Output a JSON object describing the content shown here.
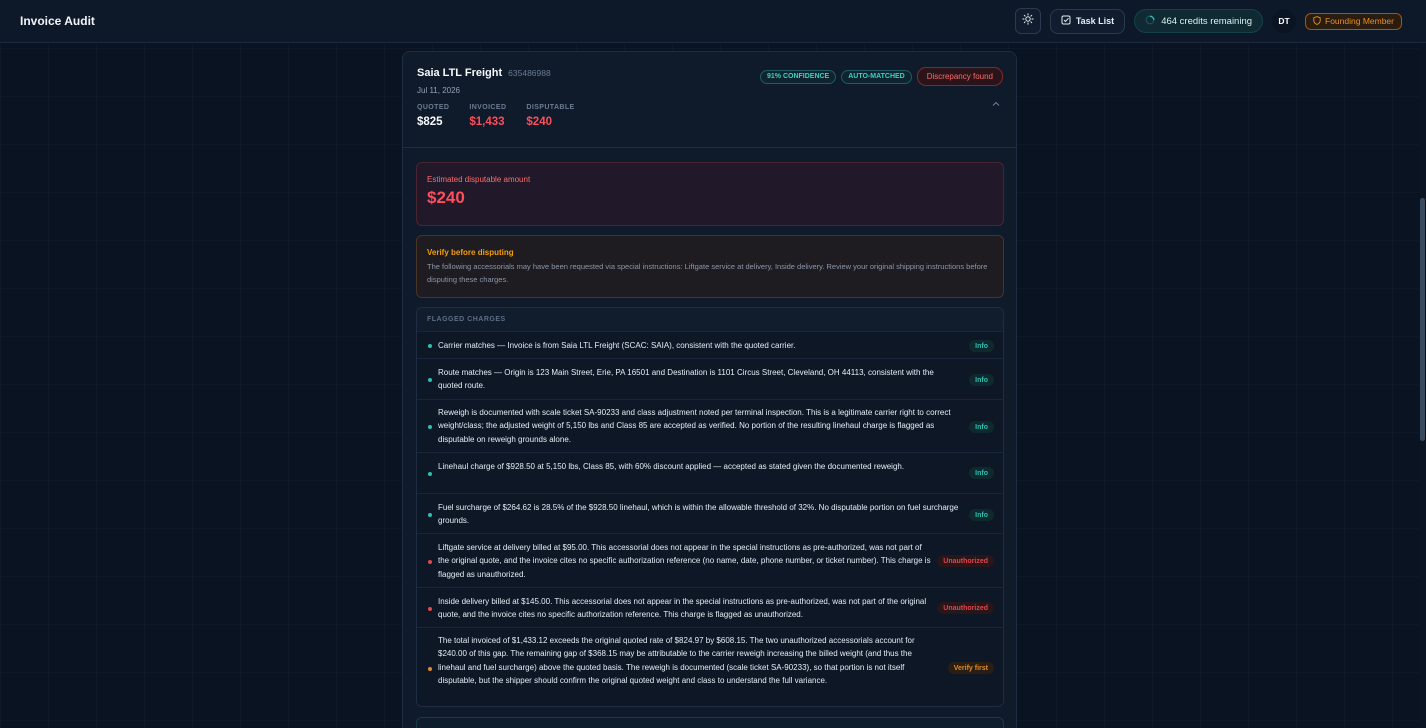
{
  "app": {
    "title": "Invoice Audit"
  },
  "header": {
    "task_list_label": "Task List",
    "credits_label": "464 credits remaining",
    "avatar_initials": "DT",
    "member_label": "Founding Member"
  },
  "invoice": {
    "carrier": "Saia LTL Freight",
    "invoice_number": "635486988",
    "date": "Jul 11, 2026",
    "confidence_badge": "91% CONFIDENCE",
    "match_badge": "AUTO-MATCHED",
    "status_badge": "Discrepancy found",
    "amounts": [
      {
        "label": "QUOTED",
        "value": "$825"
      },
      {
        "label": "INVOICED",
        "value": "$1,433"
      },
      {
        "label": "DISPUTABLE",
        "value": "$240"
      }
    ]
  },
  "estimate": {
    "label": "Estimated disputable amount",
    "value": "$240"
  },
  "verify": {
    "title": "Verify before disputing",
    "text": "The following accessorials may have been requested via special instructions: Liftgate service at delivery, Inside delivery. Review your original shipping instructions before disputing these charges."
  },
  "flagged": {
    "heading": "FLAGGED CHARGES",
    "items": [
      {
        "text": "Carrier matches — Invoice is from Saia LTL Freight (SCAC: SAIA), consistent with the quoted carrier.",
        "tag": "Info"
      },
      {
        "text": "Route matches — Origin is 123 Main Street, Erie, PA 16501 and Destination is 1101 Circus Street, Cleveland, OH 44113, consistent with the quoted route.",
        "tag": "Info"
      },
      {
        "text": "Reweigh is documented with scale ticket SA-90233 and class adjustment noted per terminal inspection. This is a legitimate carrier right to correct weight/class; the adjusted weight of 5,150 lbs and Class 85 are accepted as verified. No portion of the resulting linehaul charge is flagged as disputable on reweigh grounds alone.",
        "tag": "Info"
      },
      {
        "text": "Linehaul charge of $928.50 at 5,150 lbs, Class 85, with 60% discount applied — accepted as stated given the documented reweigh.",
        "tag": "Info"
      },
      {
        "text": "Fuel surcharge of $264.62 is 28.5% of the $928.50 linehaul, which is within the allowable threshold of 32%. No disputable portion on fuel surcharge grounds.",
        "tag": "Info"
      },
      {
        "text": "Liftgate service at delivery billed at $95.00. This accessorial does not appear in the special instructions as pre-authorized, was not part of the original quote, and the invoice cites no specific authorization reference (no name, date, phone number, or ticket number). This charge is flagged as unauthorized.",
        "tag": "Unauthorized"
      },
      {
        "text": "Inside delivery billed at $145.00. This accessorial does not appear in the special instructions as pre-authorized, was not part of the original quote, and the invoice cites no specific authorization reference. This charge is flagged as unauthorized.",
        "tag": "Unauthorized"
      },
      {
        "text": "The total invoiced of $1,433.12 exceeds the original quoted rate of $824.97 by $608.15. The two unauthorized accessorials account for $240.00 of this gap. The remaining gap of $368.15 may be attributable to the carrier reweigh increasing the billed weight (and thus the linehaul and fuel surcharge) above the quoted basis. The reweigh is documented (scale ticket SA-90233), so that portion is not itself disputable, but the shipper should confirm the original quoted weight and class to understand the full variance.",
        "tag": "Verify first"
      }
    ]
  },
  "colors": {
    "info": "#2fbfb0",
    "unauthorized": "#e0474f",
    "verify": "#e08a2a",
    "disputable": "#ff4d5a"
  }
}
